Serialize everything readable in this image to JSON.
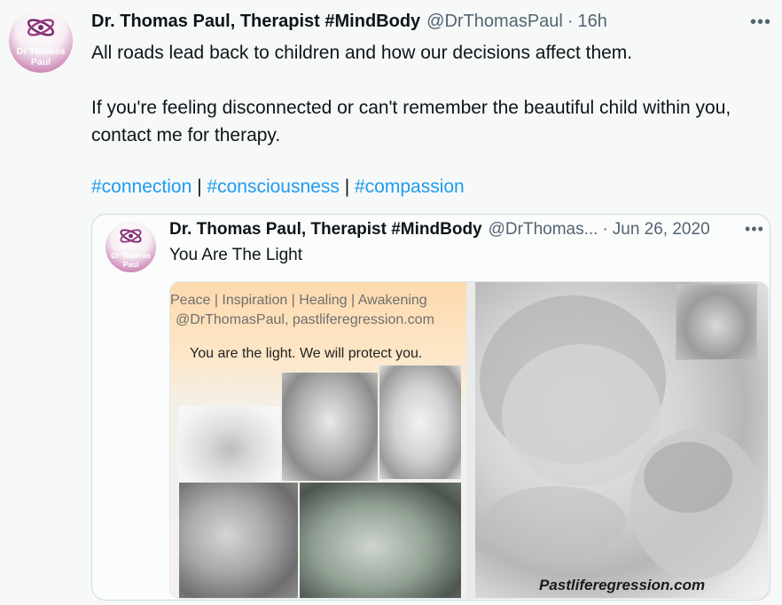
{
  "tweet": {
    "avatar_text_line1": "Dr Thomas",
    "avatar_text_line2": "Paul",
    "author_name": "Dr. Thomas Paul, Therapist #MindBody",
    "author_handle": "@DrThomasPaul",
    "separator": "·",
    "time": "16h",
    "more": "•••",
    "text_line1": "All roads lead back to children and how our decisions affect them.",
    "text_line2": "If you're feeling disconnected or can't remember the beautiful child within you, contact me for therapy.",
    "hashtags": [
      {
        "text": "#connection"
      },
      {
        "text": "#consciousness"
      },
      {
        "text": "#compassion"
      }
    ],
    "hashtag_separator": "|",
    "link_color": "#1d9bf0"
  },
  "quoted_tweet": {
    "avatar_text_line1": "Dr Thomas",
    "avatar_text_line2": "Paul",
    "author_name": "Dr. Thomas Paul, Therapist #MindBody",
    "author_handle": "@DrThomas...",
    "separator": "·",
    "date": "Jun 26, 2020",
    "more": "•••",
    "text": "You Are The Light",
    "media": {
      "line1": "Peace | Inspiration | Healing | Awakening",
      "line2": "@DrThomasPaul, pastliferegression.com",
      "line3": "You are the light. We will protect you.",
      "watermark": "Pastliferegression.com"
    }
  }
}
